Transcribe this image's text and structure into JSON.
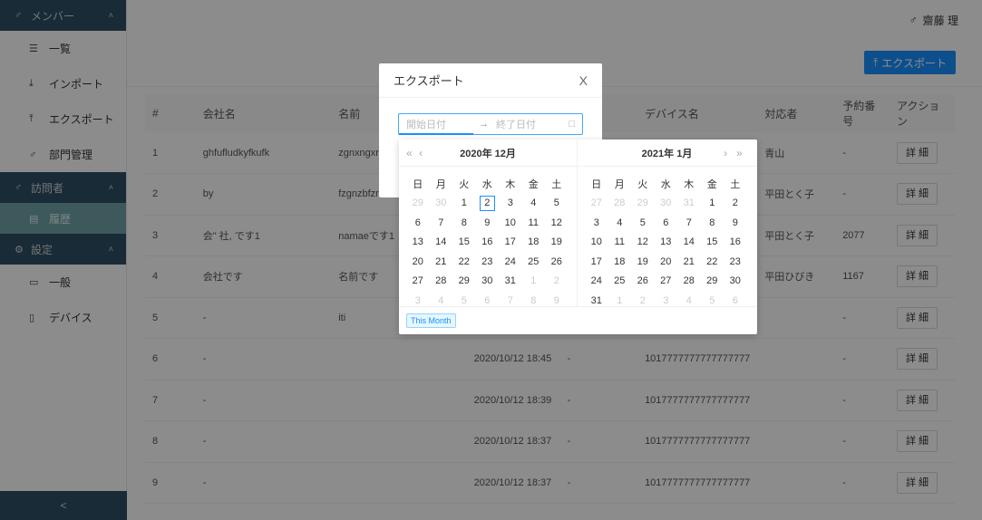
{
  "sidebar": {
    "groups": [
      {
        "label": "メンバー",
        "items": [
          "一覧",
          "インポート",
          "エクスポート",
          "部門管理"
        ]
      },
      {
        "label": "訪問者",
        "items": [
          "履歴"
        ]
      },
      {
        "label": "設定",
        "items": [
          "一般",
          "デバイス"
        ]
      }
    ],
    "collapse_label": "<"
  },
  "header": {
    "user_name": "齋藤 理"
  },
  "toolbar": {
    "export_label": "エクスポート"
  },
  "table": {
    "columns": [
      "#",
      "会社名",
      "名前",
      "",
      "",
      "デバイス名",
      "対応者",
      "予約番号",
      "アクション"
    ],
    "detail_label": "詳 細",
    "rows": [
      {
        "no": "1",
        "company": "ghfufludkyfkufk",
        "name": "zgnxngxng",
        "time": "",
        "dash": "",
        "device": "",
        "handler": "青山",
        "booking": "-"
      },
      {
        "no": "2",
        "company": "by",
        "name": "fzgnzbfznfz",
        "time": "",
        "dash": "",
        "device": "",
        "handler": "平田とく子",
        "booking": "-"
      },
      {
        "no": "3",
        "company": "会\" 社, です1",
        "name": "namaeです1",
        "time": "",
        "dash": "",
        "device": "",
        "handler": "平田とく子",
        "booking": "2077"
      },
      {
        "no": "4",
        "company": "会社です",
        "name": "名前です",
        "time": "",
        "dash": "",
        "device": "",
        "handler": "平田ひびき",
        "booking": "1167"
      },
      {
        "no": "5",
        "company": "-",
        "name": "iti",
        "time": "",
        "dash": "",
        "device": "",
        "handler": "",
        "booking": "-"
      },
      {
        "no": "6",
        "company": "-",
        "name": "",
        "time": "2020/10/12 18:45",
        "dash": "-",
        "device": "1017777777777777777",
        "handler": "",
        "booking": "-"
      },
      {
        "no": "7",
        "company": "-",
        "name": "",
        "time": "2020/10/12 18:39",
        "dash": "-",
        "device": "1017777777777777777",
        "handler": "",
        "booking": "-"
      },
      {
        "no": "8",
        "company": "-",
        "name": "",
        "time": "2020/10/12 18:37",
        "dash": "-",
        "device": "1017777777777777777",
        "handler": "",
        "booking": "-"
      },
      {
        "no": "9",
        "company": "-",
        "name": "",
        "time": "2020/10/12 18:37",
        "dash": "-",
        "device": "1017777777777777777",
        "handler": "",
        "booking": "-"
      }
    ]
  },
  "modal": {
    "title": "エクスポート",
    "close": "X",
    "start_placeholder": "開始日付",
    "arrow": "→",
    "end_placeholder": "終了日付"
  },
  "picker": {
    "weekdays": [
      "日",
      "月",
      "火",
      "水",
      "木",
      "金",
      "土"
    ],
    "left": {
      "title": "2020年 12月",
      "nav_prev_year": "«",
      "nav_prev_month": "‹",
      "weeks": [
        [
          [
            "29",
            1
          ],
          [
            "30",
            1
          ],
          [
            "1",
            0
          ],
          [
            "2",
            2
          ],
          [
            "3",
            0
          ],
          [
            "4",
            0
          ],
          [
            "5",
            0
          ]
        ],
        [
          [
            "6",
            0
          ],
          [
            "7",
            0
          ],
          [
            "8",
            0
          ],
          [
            "9",
            0
          ],
          [
            "10",
            0
          ],
          [
            "11",
            0
          ],
          [
            "12",
            0
          ]
        ],
        [
          [
            "13",
            0
          ],
          [
            "14",
            0
          ],
          [
            "15",
            0
          ],
          [
            "16",
            0
          ],
          [
            "17",
            0
          ],
          [
            "18",
            0
          ],
          [
            "19",
            0
          ]
        ],
        [
          [
            "20",
            0
          ],
          [
            "21",
            0
          ],
          [
            "22",
            0
          ],
          [
            "23",
            0
          ],
          [
            "24",
            0
          ],
          [
            "25",
            0
          ],
          [
            "26",
            0
          ]
        ],
        [
          [
            "27",
            0
          ],
          [
            "28",
            0
          ],
          [
            "29",
            0
          ],
          [
            "30",
            0
          ],
          [
            "31",
            0
          ],
          [
            "1",
            1
          ],
          [
            "2",
            1
          ]
        ],
        [
          [
            "3",
            1
          ],
          [
            "4",
            1
          ],
          [
            "5",
            1
          ],
          [
            "6",
            1
          ],
          [
            "7",
            1
          ],
          [
            "8",
            1
          ],
          [
            "9",
            1
          ]
        ]
      ]
    },
    "right": {
      "title": "2021年 1月",
      "nav_next_month": "›",
      "nav_next_year": "»",
      "weeks": [
        [
          [
            "27",
            1
          ],
          [
            "28",
            1
          ],
          [
            "29",
            1
          ],
          [
            "30",
            1
          ],
          [
            "31",
            1
          ],
          [
            "1",
            0
          ],
          [
            "2",
            0
          ]
        ],
        [
          [
            "3",
            0
          ],
          [
            "4",
            0
          ],
          [
            "5",
            0
          ],
          [
            "6",
            0
          ],
          [
            "7",
            0
          ],
          [
            "8",
            0
          ],
          [
            "9",
            0
          ]
        ],
        [
          [
            "10",
            0
          ],
          [
            "11",
            0
          ],
          [
            "12",
            0
          ],
          [
            "13",
            0
          ],
          [
            "14",
            0
          ],
          [
            "15",
            0
          ],
          [
            "16",
            0
          ]
        ],
        [
          [
            "17",
            0
          ],
          [
            "18",
            0
          ],
          [
            "19",
            0
          ],
          [
            "20",
            0
          ],
          [
            "21",
            0
          ],
          [
            "22",
            0
          ],
          [
            "23",
            0
          ]
        ],
        [
          [
            "24",
            0
          ],
          [
            "25",
            0
          ],
          [
            "26",
            0
          ],
          [
            "27",
            0
          ],
          [
            "28",
            0
          ],
          [
            "29",
            0
          ],
          [
            "30",
            0
          ]
        ],
        [
          [
            "31",
            0
          ],
          [
            "1",
            1
          ],
          [
            "2",
            1
          ],
          [
            "3",
            1
          ],
          [
            "4",
            1
          ],
          [
            "5",
            1
          ],
          [
            "6",
            1
          ]
        ]
      ]
    },
    "preset_label": "This Month"
  },
  "colors": {
    "sidebar_dark": "#2f4f63",
    "sidebar_selected": "#6fa3a8",
    "primary": "#1890ff"
  },
  "icons": {
    "members": "members-icon",
    "visitors": "visitors-icon",
    "settings": "gear-icon",
    "user": "user-icon",
    "calendar": "calendar-icon"
  }
}
